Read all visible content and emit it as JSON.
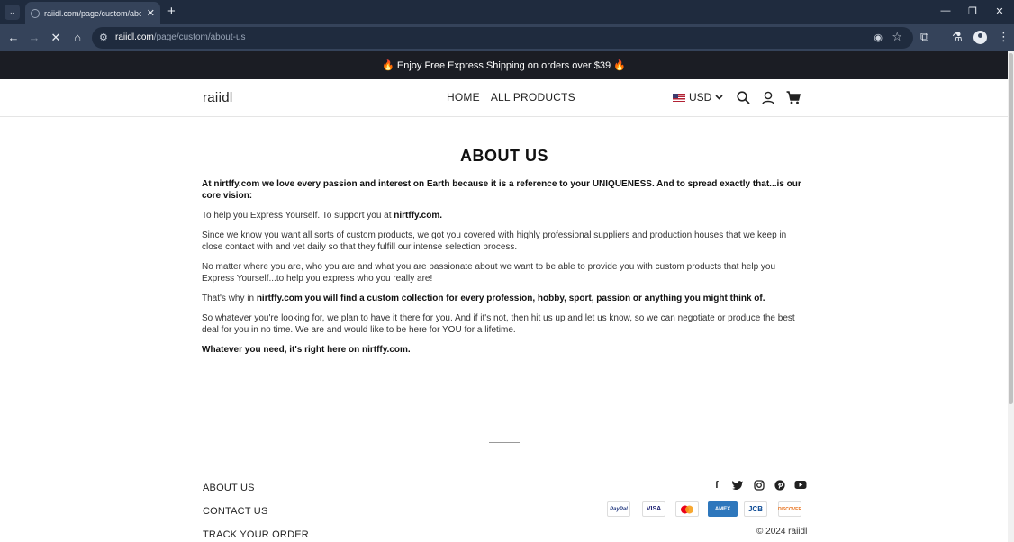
{
  "browser": {
    "tab_title": "raiidl.com/page/custom/about-us",
    "tab_close": "✕",
    "new_tab": "+",
    "url_host": "raiidl.com",
    "url_path": "/page/custom/about-us",
    "window_buttons": [
      "—",
      "❐",
      "✕"
    ]
  },
  "announcement": "🔥 Enjoy Free Express Shipping on orders over $39 🔥",
  "header": {
    "logo": "raiidl",
    "nav": [
      "HOME",
      "ALL PRODUCTS"
    ],
    "currency": "USD"
  },
  "content": {
    "title": "ABOUT US",
    "p1": "At nirtffy.com we love every passion and interest on Earth because it is a reference to your UNIQUENESS. And to spread exactly that...is our core vision:",
    "p2_text": "To help you Express Yourself. To support you at ",
    "p2_bold": "nirtffy.com.",
    "p3": "Since we know you want all sorts of custom products, we got you covered with highly professional suppliers and production houses that we keep in close contact with and vet daily so that they fulfill our intense selection process.",
    "p4": "No matter where you are, who you are and what you are passionate about we want to be able to provide you with custom products that help you Express Yourself...to help you express who you really are!",
    "p5_text": "That's why in ",
    "p5_bold": "nirtffy.com you will find a custom collection for every profession, hobby, sport, passion or anything you might think of.",
    "p6": "So whatever you're looking for, we plan to have it there for you. And if it's not, then hit us up and let us know, so we can negotiate or produce the best deal for you in no time. We are and would like to be here for YOU for a lifetime.",
    "p7": "Whatever you need, it's right here on nirtffy.com."
  },
  "footer": {
    "links": [
      "ABOUT US",
      "CONTACT US",
      "TRACK YOUR ORDER"
    ],
    "social_icons": [
      "facebook-icon",
      "twitter-icon",
      "instagram-icon",
      "pinterest-icon",
      "youtube-icon"
    ],
    "payments": [
      "PayPal",
      "VISA",
      "",
      "AMEX",
      "JCB",
      "DISCOVER"
    ],
    "copyright": "© 2024 raiidl"
  },
  "colors": {
    "chrome_dark": "#1f2b3e",
    "chrome_toolbar": "#35435a",
    "announce_bg": "#1b1d24"
  }
}
